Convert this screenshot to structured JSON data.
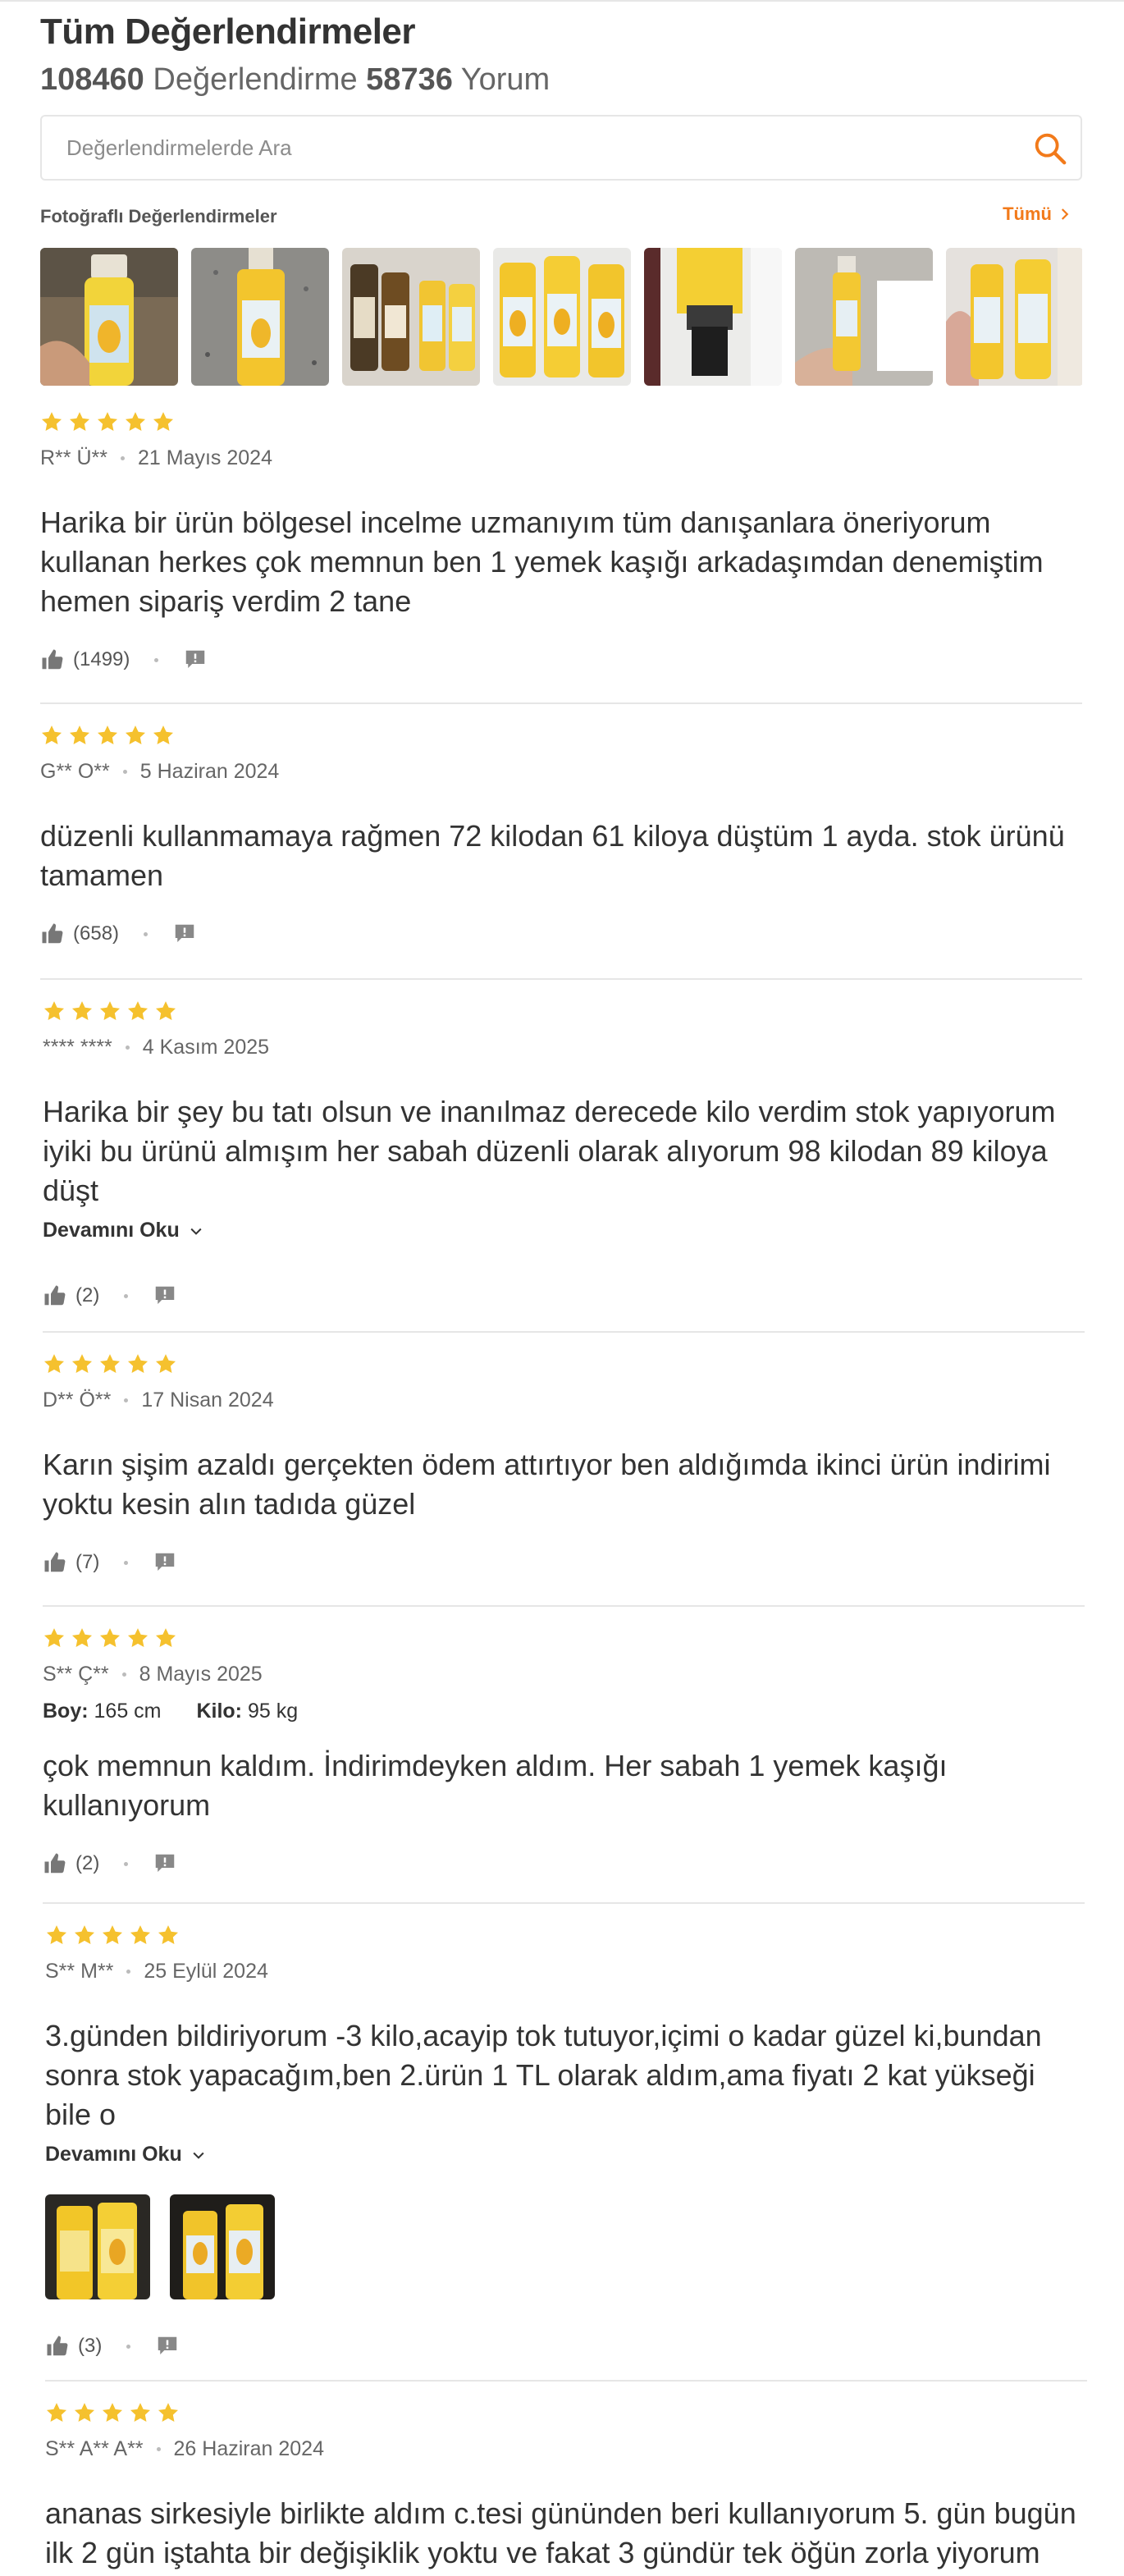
{
  "header": {
    "title": "Tüm Değerlendirmeler",
    "rating_count": "108460",
    "rating_label": "Değerlendirme",
    "comment_count": "58736",
    "comment_label": "Yorum"
  },
  "search": {
    "placeholder": "Değerlendirmelerde Ara",
    "value": ""
  },
  "photos_section": {
    "title": "Fotoğraflı Değerlendirmeler",
    "all_link": "Tümü",
    "count_visible": 7
  },
  "reviews": [
    {
      "stars": 5,
      "author": "R** Ü**",
      "date": "21 Mayıs 2024",
      "text": "Harika bir ürün bölgesel incelme uzmanıyım tüm danışanlara öneriyorum kullanan herkes çok memnun ben 1 yemek kaşığı arkadaşımdan denemiştim hemen sipariş verdim 2 tane",
      "likes": "(1499)"
    },
    {
      "stars": 5,
      "author": "G** O**",
      "date": "5 Haziran 2024",
      "text": "düzenli kullanmamaya rağmen 72 kilodan 61 kiloya düştüm 1 ayda. stok ürünü tamamen",
      "likes": "(658)"
    },
    {
      "stars": 5,
      "author": "**** ****",
      "date": "4 Kasım 2025",
      "text": "Harika bir şey bu tatı olsun ve inanılmaz derecede kilo verdim stok yapıyorum iyiki bu ürünü almışım her sabah düzenli olarak alıyorum 98 kilodan 89 kiloya düşt",
      "read_more": "Devamını Oku",
      "likes": "(2)"
    },
    {
      "stars": 5,
      "author": "D** Ö**",
      "date": "17 Nisan 2024",
      "text": "Karın şişim azaldı gerçekten ödem attırtıyor ben aldığımda ikinci ürün indirimi yoktu kesin alın tadıda güzel",
      "likes": "(7)"
    },
    {
      "stars": 5,
      "author": "S** Ç**",
      "date": "8 Mayıs 2025",
      "height_label": "Boy:",
      "height_value": "165 cm",
      "weight_label": "Kilo:",
      "weight_value": "95 kg",
      "text": "çok memnun kaldım. İndirimdeyken aldım. Her sabah 1 yemek kaşığı kullanıyorum",
      "likes": "(2)"
    },
    {
      "stars": 5,
      "author": "S** M**",
      "date": "25 Eylül 2024",
      "text": "3.günden bildiriyorum -3 kilo,acayip tok tutuyor,içimi o kadar güzel ki,bundan sonra stok yapacağım,ben 2.ürün 1 TL olarak aldım,ama fiyatı 2 kat yükseği bile o",
      "read_more": "Devamını Oku",
      "likes": "(3)"
    },
    {
      "stars": 5,
      "author": "S** A** A**",
      "date": "26 Haziran 2024",
      "text": "ananas sirkesiyle birlikte aldım c.tesi gününden beri kullanıyorum 5. gün bugün ilk 2 gün iştahta bir değişiklik yoktu ve fakat 3 gündür tek öğün zorla yiyorum"
    }
  ],
  "colors": {
    "accent": "#f27a1a",
    "star": "#f5c12e",
    "text": "#333333",
    "muted": "#666666",
    "divider": "#e6e6e6"
  },
  "icons": {
    "search": "search-icon",
    "like": "thumbs-up-icon",
    "report": "report-flag-icon",
    "chevron": "chevron-down-icon"
  }
}
